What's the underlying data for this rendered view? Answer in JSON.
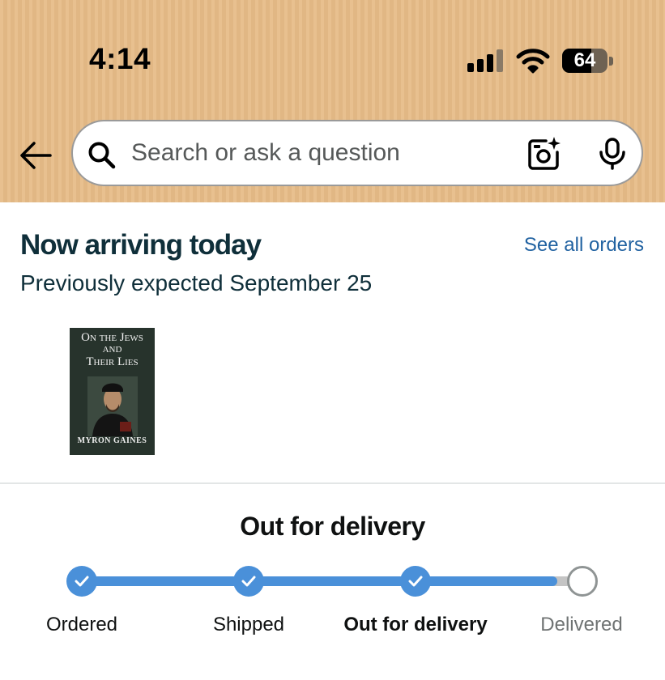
{
  "status_bar": {
    "time": "4:14",
    "battery": "64",
    "battery_level": 0.64
  },
  "header": {
    "background_color": "#e6bb87",
    "back_icon": "arrow-left-icon",
    "search": {
      "placeholder": "Search or ask a question",
      "value": "",
      "search_icon": "magnifier-icon",
      "camera_icon": "camera-sparkle-icon",
      "mic_icon": "microphone-icon"
    }
  },
  "order": {
    "headline": "Now arriving today",
    "see_all_label": "See all orders",
    "subline": "Previously expected September 25",
    "link_color": "#2162a1",
    "item": {
      "cover_title_line1": "On the Jews",
      "cover_title_line2": "and",
      "cover_title_line3": "Their Lies",
      "cover_author": "Myron Gaines"
    }
  },
  "tracking": {
    "status_title": "Out for delivery",
    "progress": 0.95,
    "accent_color": "#4a90d9",
    "steps": [
      {
        "label": "Ordered",
        "state": "done"
      },
      {
        "label": "Shipped",
        "state": "done"
      },
      {
        "label": "Out for delivery",
        "state": "current"
      },
      {
        "label": "Delivered",
        "state": "pending"
      }
    ]
  }
}
